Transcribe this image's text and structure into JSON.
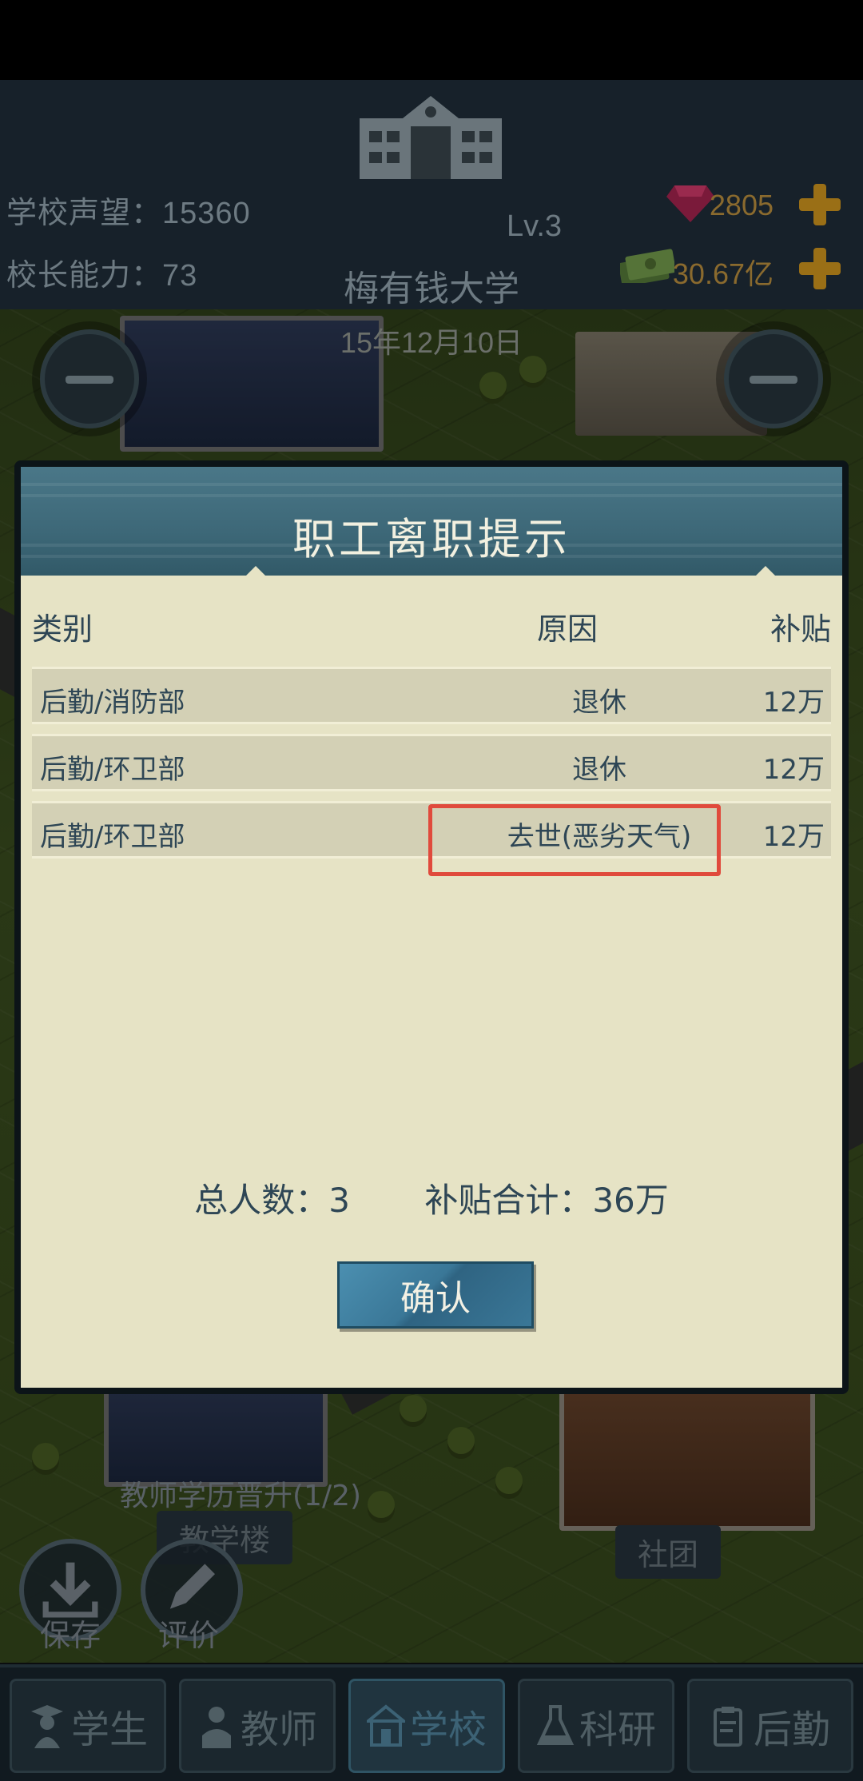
{
  "header": {
    "reputation_label": "学校声望：15360",
    "ability_label": "校长能力：73",
    "level": "Lv.3",
    "school_name": "梅有钱大学",
    "gems": "2805",
    "money": "30.67亿",
    "date": "15年12月10日"
  },
  "modal": {
    "title": "职工离职提示",
    "columns": {
      "category": "类别",
      "reason": "原因",
      "allowance": "补贴"
    },
    "rows": [
      {
        "category": "后勤/消防部",
        "reason": "退休",
        "allowance": "12万"
      },
      {
        "category": "后勤/环卫部",
        "reason": "退休",
        "allowance": "12万"
      },
      {
        "category": "后勤/环卫部",
        "reason": "去世(恶劣天气)",
        "allowance": "12万"
      }
    ],
    "total_people": "总人数：3",
    "total_allowance": "补贴合计：36万",
    "confirm_label": "确认"
  },
  "map": {
    "task_text": "教师学历晋升(1/2)",
    "building_teaching": "教学楼",
    "building_club": "社团",
    "save_label": "保存",
    "review_label": "评价"
  },
  "tabs": [
    {
      "label": "学生",
      "icon": "student-icon"
    },
    {
      "label": "教师",
      "icon": "teacher-icon"
    },
    {
      "label": "学校",
      "icon": "school-icon",
      "active": true
    },
    {
      "label": "科研",
      "icon": "flask-icon"
    },
    {
      "label": "后勤",
      "icon": "clipboard-icon"
    }
  ],
  "colors": {
    "highlight": "#e04a3c",
    "modal_header": "#3d6878",
    "modal_bg": "#e6e3c5"
  }
}
